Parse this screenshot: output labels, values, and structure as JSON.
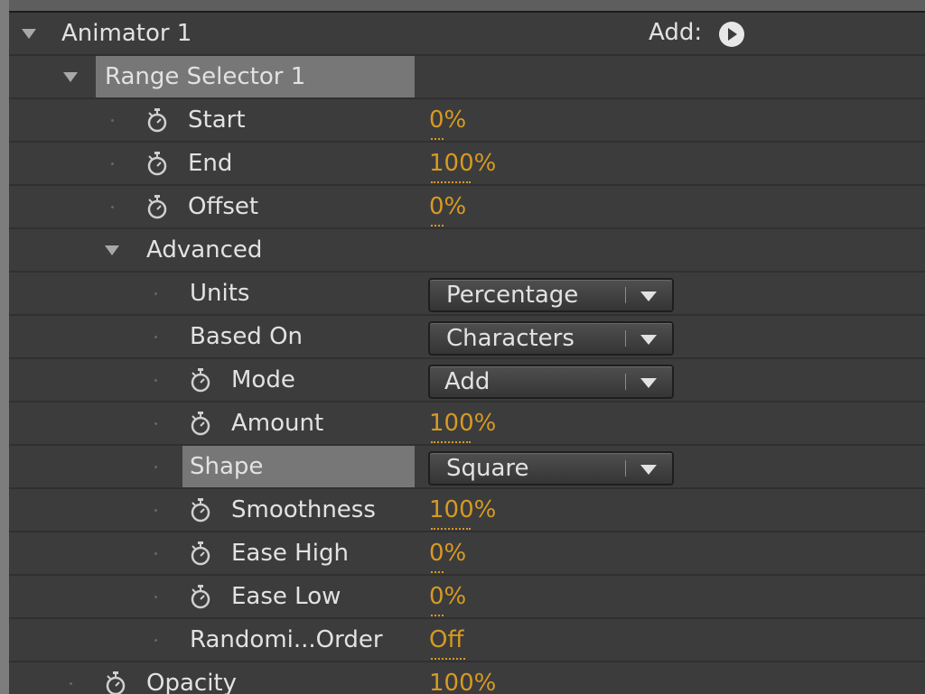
{
  "animator": {
    "label": "Animator 1",
    "add_label": "Add:"
  },
  "range_selector": {
    "label": "Range Selector 1"
  },
  "properties": {
    "start": {
      "label": "Start",
      "value": "0%"
    },
    "end": {
      "label": "End",
      "value": "100%"
    },
    "offset": {
      "label": "Offset",
      "value": "0%"
    }
  },
  "advanced": {
    "label": "Advanced",
    "units": {
      "label": "Units",
      "value": "Percentage"
    },
    "based_on": {
      "label": "Based On",
      "value": "Characters"
    },
    "mode": {
      "label": "Mode",
      "value": "Add"
    },
    "amount": {
      "label": "Amount",
      "value": "100%"
    },
    "shape": {
      "label": "Shape",
      "value": "Square"
    },
    "smoothness": {
      "label": "Smoothness",
      "value": "100%"
    },
    "ease_high": {
      "label": "Ease High",
      "value": "0%"
    },
    "ease_low": {
      "label": "Ease Low",
      "value": "0%"
    },
    "randomize_order": {
      "label": "Randomi...Order",
      "value": "Off"
    }
  },
  "opacity": {
    "label": "Opacity",
    "value": "100%"
  },
  "colors": {
    "value_accent": "#d69a22",
    "panel_bg": "#3c3c3c",
    "selection": "#777777"
  },
  "icons": {
    "stopwatch": "stopwatch-icon",
    "twirl": "twirl-down-icon",
    "add_menu": "play-arrow-icon",
    "dropdown": "chevron-down-icon"
  }
}
